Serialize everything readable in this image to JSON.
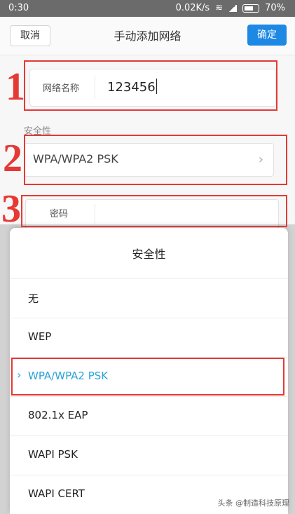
{
  "status": {
    "time": "0:30",
    "speed": "0.02K/s",
    "battery": "70%"
  },
  "header": {
    "cancel_label": "取消",
    "title": "手动添加网络",
    "confirm_label": "确定"
  },
  "form": {
    "network_name_label": "网络名称",
    "network_name_value": "123456",
    "security_section_label": "安全性",
    "security_value": "WPA/WPA2 PSK",
    "password_label": "密码"
  },
  "sheet": {
    "title": "安全性",
    "options": [
      {
        "label": "无"
      },
      {
        "label": "WEP"
      },
      {
        "label": "WPA/WPA2 PSK",
        "selected": true
      },
      {
        "label": "802.1x EAP"
      },
      {
        "label": "WAPI PSK"
      },
      {
        "label": "WAPI CERT"
      }
    ]
  },
  "annotations": [
    "1",
    "2",
    "3"
  ],
  "watermark": "头条 @制造科技原理",
  "colors": {
    "accent": "#1e88e5",
    "selected": "#29a3d8",
    "annotation": "#e53935"
  }
}
